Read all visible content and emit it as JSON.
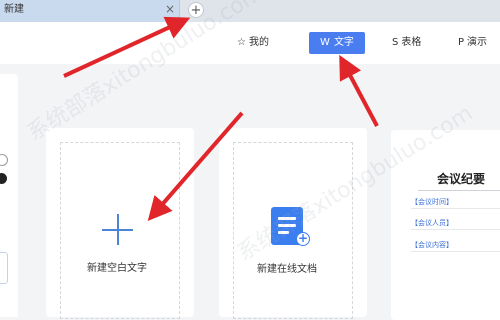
{
  "tabbar": {
    "tab_label": "新建",
    "close_glyph": "×",
    "add_glyph": "+"
  },
  "toolbar": {
    "mine": {
      "icon": "star-icon",
      "glyph": "☆",
      "label": "我的"
    },
    "text": {
      "icon": "w-doc-icon",
      "glyph": "W",
      "label": "文字"
    },
    "sheet": {
      "icon": "s-sheet-icon",
      "glyph": "S",
      "label": "表格"
    },
    "present": {
      "icon": "p-present-icon",
      "glyph": "P",
      "label": "演示"
    }
  },
  "cards": {
    "blank": {
      "label": "新建空白文字",
      "icon": "plus-icon"
    },
    "online": {
      "label": "新建在线文档",
      "icon": "online-doc-icon",
      "badge_glyph": "+"
    },
    "template": {
      "title": "会议纪要",
      "fields": [
        "【会议时间】",
        "【会议人员】",
        "【会议内容】"
      ]
    }
  },
  "watermark": "系统部落xitongbuluo.com",
  "colors": {
    "accent": "#4a7df0",
    "arrow": "#e0262a",
    "plus": "#4b83d6"
  }
}
